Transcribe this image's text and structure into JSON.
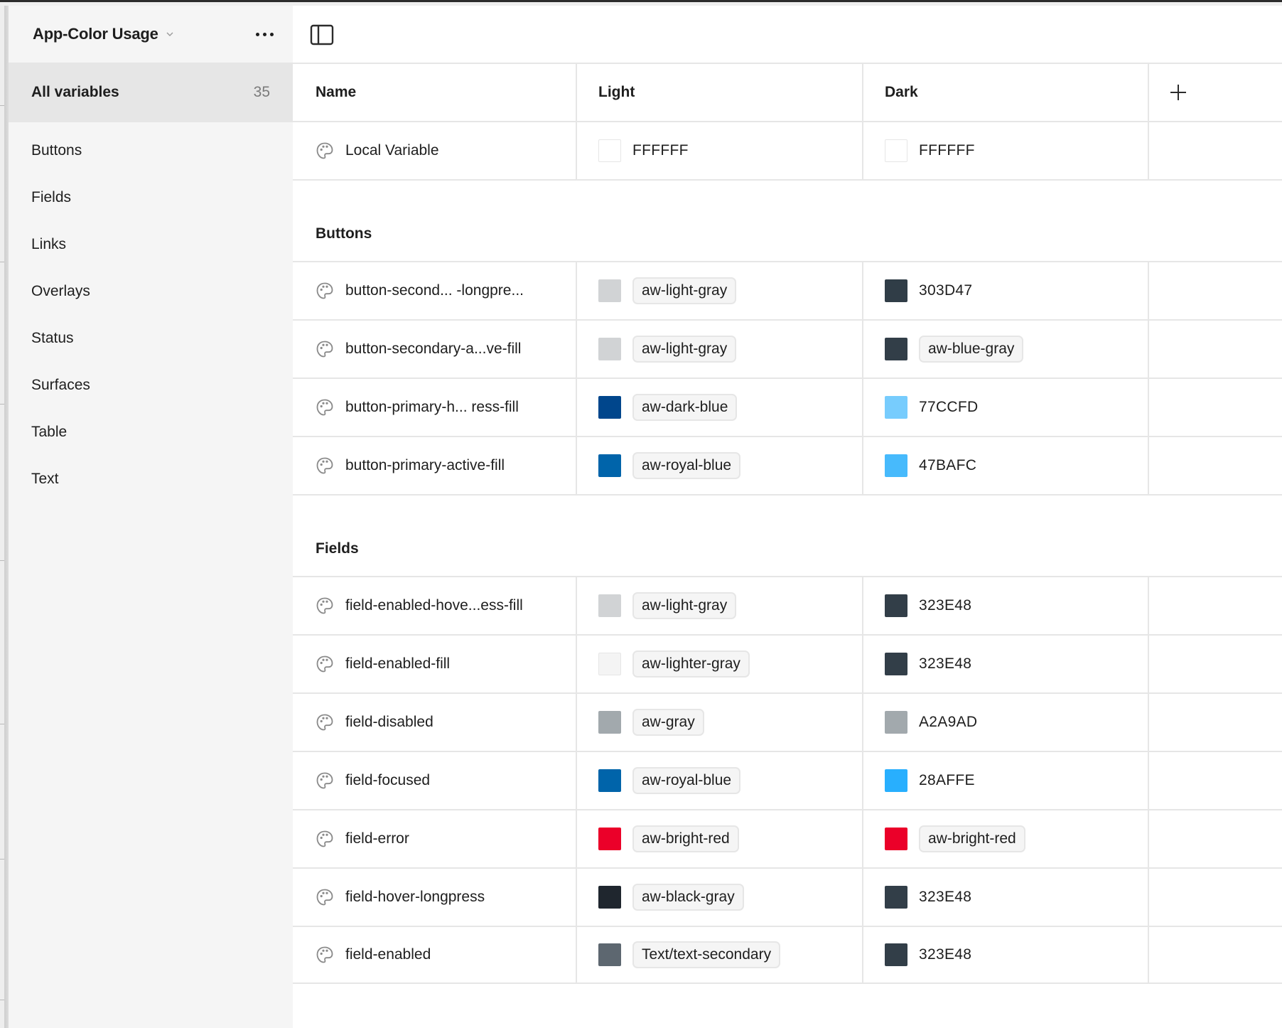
{
  "sidebar": {
    "collection_title": "App-Color Usage",
    "all_variables": {
      "label": "All variables",
      "count": "35"
    },
    "groups": [
      "Buttons",
      "Fields",
      "Links",
      "Overlays",
      "Status",
      "Surfaces",
      "Table",
      "Text"
    ]
  },
  "table": {
    "columns": {
      "name": "Name",
      "light": "Light",
      "dark": "Dark"
    },
    "ungrouped": [
      {
        "name": "Local Variable",
        "light": {
          "color": "#FFFFFF",
          "label": "FFFFFF",
          "alias": false
        },
        "dark": {
          "color": "#FFFFFF",
          "label": "FFFFFF",
          "alias": false
        }
      }
    ],
    "sections": [
      {
        "title": "Buttons",
        "rows": [
          {
            "name": "button-second... -longpre...",
            "light": {
              "color": "#D1D3D5",
              "label": "aw-light-gray",
              "alias": true
            },
            "dark": {
              "color": "#303D47",
              "label": "303D47",
              "alias": false
            }
          },
          {
            "name": "button-secondary-a...ve-fill",
            "light": {
              "color": "#D1D3D5",
              "label": "aw-light-gray",
              "alias": true
            },
            "dark": {
              "color": "#323E48",
              "label": "aw-blue-gray",
              "alias": true
            }
          },
          {
            "name": "button-primary-h...  ress-fill",
            "light": {
              "color": "#00468C",
              "label": "aw-dark-blue",
              "alias": true
            },
            "dark": {
              "color": "#77CCFD",
              "label": "77CCFD",
              "alias": false
            }
          },
          {
            "name": "button-primary-active-fill",
            "light": {
              "color": "#0064AA",
              "label": "aw-royal-blue",
              "alias": true
            },
            "dark": {
              "color": "#47BAFC",
              "label": "47BAFC",
              "alias": false
            }
          }
        ]
      },
      {
        "title": "Fields",
        "rows": [
          {
            "name": "field-enabled-hove...ess-fill",
            "light": {
              "color": "#D1D3D5",
              "label": "aw-light-gray",
              "alias": true
            },
            "dark": {
              "color": "#323E48",
              "label": "323E48",
              "alias": false
            }
          },
          {
            "name": "field-enabled-fill",
            "light": {
              "color": "#F4F4F4",
              "label": "aw-lighter-gray",
              "alias": true
            },
            "dark": {
              "color": "#323E48",
              "label": "323E48",
              "alias": false
            }
          },
          {
            "name": "field-disabled",
            "light": {
              "color": "#A2A9AD",
              "label": "aw-gray",
              "alias": true
            },
            "dark": {
              "color": "#A2A9AD",
              "label": "A2A9AD",
              "alias": false
            }
          },
          {
            "name": "field-focused",
            "light": {
              "color": "#0064AA",
              "label": "aw-royal-blue",
              "alias": true
            },
            "dark": {
              "color": "#28AFFE",
              "label": "28AFFE",
              "alias": false
            }
          },
          {
            "name": "field-error",
            "light": {
              "color": "#EB0029",
              "label": "aw-bright-red",
              "alias": true
            },
            "dark": {
              "color": "#EB0029",
              "label": "aw-bright-red",
              "alias": true
            }
          },
          {
            "name": "field-hover-longpress",
            "light": {
              "color": "#1F262E",
              "label": "aw-black-gray",
              "alias": true
            },
            "dark": {
              "color": "#323E48",
              "label": "323E48",
              "alias": false
            }
          },
          {
            "name": "field-enabled",
            "light": {
              "color": "#5D6770",
              "label": "Text/text-secondary",
              "alias": true
            },
            "dark": {
              "color": "#323E48",
              "label": "323E48",
              "alias": false
            }
          }
        ]
      }
    ]
  },
  "icons": {
    "variable_type": "palette-icon",
    "add_mode": "plus-icon",
    "panel_toggle": "sidebar-panel-icon",
    "more": "more-horizontal-icon",
    "dropdown": "chevron-down-icon"
  },
  "colors": {
    "sidebar_bg": "#F5F5F5",
    "selected_bg": "#E6E6E6",
    "border": "#E6E6E6",
    "chip_bg": "#F5F5F5",
    "text": "#1E1E1E",
    "muted_text": "#7A7A7A"
  }
}
